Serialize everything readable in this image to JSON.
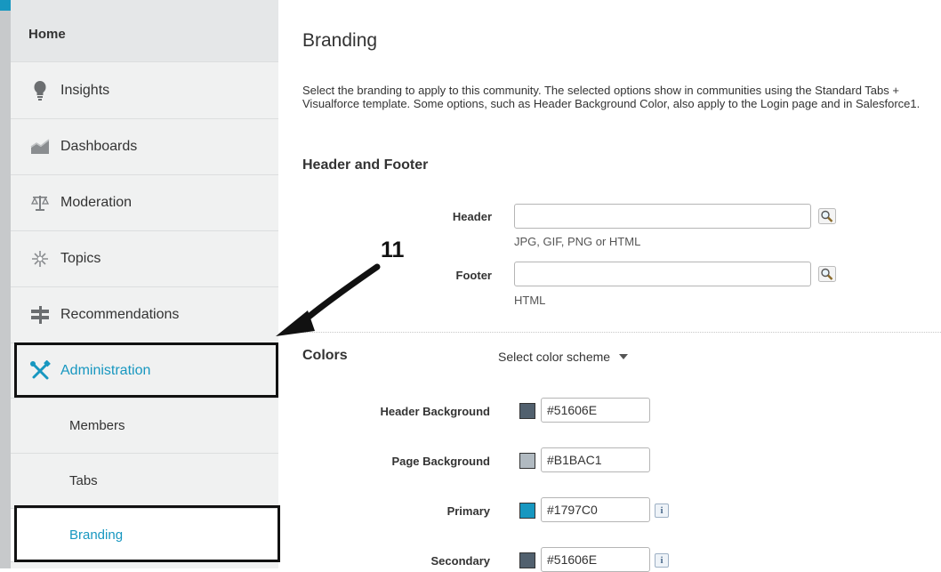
{
  "sidebar": {
    "home": "Home",
    "items": [
      {
        "label": "Insights",
        "icon": "lightbulb-icon"
      },
      {
        "label": "Dashboards",
        "icon": "chart-icon"
      },
      {
        "label": "Moderation",
        "icon": "scales-icon"
      },
      {
        "label": "Topics",
        "icon": "sparkle-icon"
      },
      {
        "label": "Recommendations",
        "icon": "signpost-icon"
      },
      {
        "label": "Administration",
        "icon": "tools-icon"
      }
    ],
    "subitems": [
      "Members",
      "Tabs",
      "Branding"
    ]
  },
  "annotation": {
    "number": "11"
  },
  "main": {
    "title": "Branding",
    "description": "Select the branding to apply to this community. The selected options show in communities using the Standard Tabs + Visualforce template. Some options, such as Header Background Color, also apply to the Login page and in Salesforce1.",
    "header_footer": {
      "title": "Header and Footer",
      "header_label": "Header",
      "header_value": "",
      "header_hint": "JPG, GIF, PNG or HTML",
      "footer_label": "Footer",
      "footer_value": "",
      "footer_hint": "HTML"
    },
    "colors": {
      "title": "Colors",
      "scheme_select": "Select color scheme",
      "rows": [
        {
          "label": "Header Background",
          "value": "#51606E",
          "swatch": "#51606E"
        },
        {
          "label": "Page Background",
          "value": "#B1BAC1",
          "swatch": "#B1BAC1"
        },
        {
          "label": "Primary",
          "value": "#1797C0",
          "swatch": "#1797C0",
          "info": "i"
        },
        {
          "label": "Secondary",
          "value": "#51606E",
          "swatch": "#51606E",
          "info": "i"
        }
      ]
    }
  },
  "colors": {
    "accent": "#1797C0",
    "sidebar_bg": "#F0F1F1"
  }
}
